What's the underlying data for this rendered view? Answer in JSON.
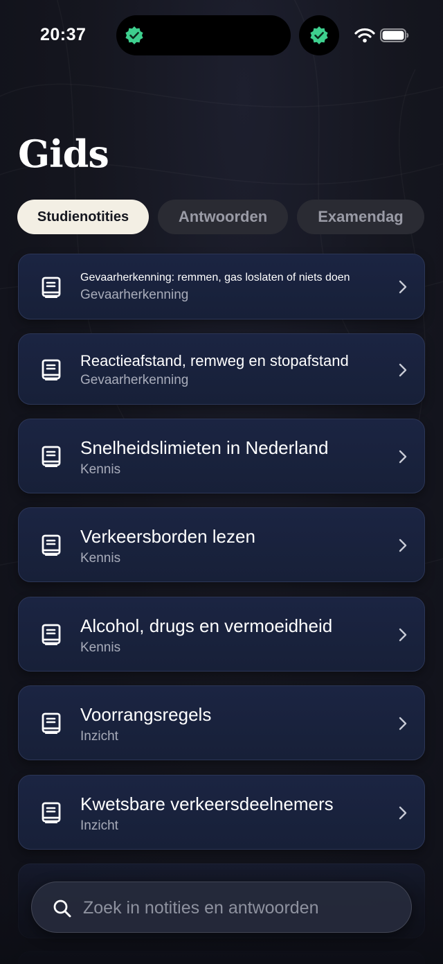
{
  "status_bar": {
    "time": "20:37"
  },
  "title": "Gids",
  "tabs": [
    {
      "label": "Studienotities",
      "active": true
    },
    {
      "label": "Antwoorden",
      "active": false
    },
    {
      "label": "Examendag",
      "active": false
    }
  ],
  "notes": [
    {
      "title": "Gevaarherkenning: remmen, gas loslaten of niets doen",
      "category": "Gevaarherkenning"
    },
    {
      "title": "Reactieafstand, remweg en stopafstand",
      "category": "Gevaarherkenning"
    },
    {
      "title": "Snelheidslimieten in Nederland",
      "category": "Kennis"
    },
    {
      "title": "Verkeersborden lezen",
      "category": "Kennis"
    },
    {
      "title": "Alcohol, drugs en vermoeidheid",
      "category": "Kennis"
    },
    {
      "title": "Voorrangsregels",
      "category": "Inzicht"
    },
    {
      "title": "Kwetsbare verkeersdeelnemers",
      "category": "Inzicht"
    }
  ],
  "search": {
    "placeholder": "Zoek in notities en antwoorden"
  },
  "colors": {
    "accent_badge": "#3ecf8e",
    "active_tab_bg": "#f3efe4",
    "card_bg": "#1b2442"
  },
  "icons": {
    "note": "book-note-icon",
    "chevron": "chevron-right-icon",
    "search": "search-icon",
    "badge": "verified-badge-icon"
  }
}
